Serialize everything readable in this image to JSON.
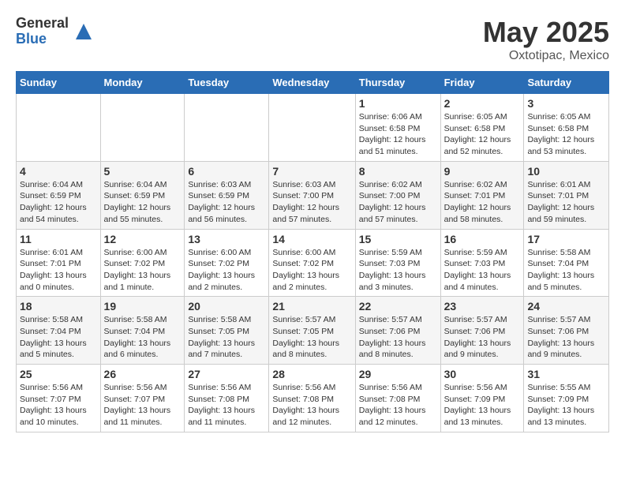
{
  "logo": {
    "general": "General",
    "blue": "Blue"
  },
  "title": "May 2025",
  "location": "Oxtotipac, Mexico",
  "days_of_week": [
    "Sunday",
    "Monday",
    "Tuesday",
    "Wednesday",
    "Thursday",
    "Friday",
    "Saturday"
  ],
  "weeks": [
    [
      {
        "day": "",
        "info": ""
      },
      {
        "day": "",
        "info": ""
      },
      {
        "day": "",
        "info": ""
      },
      {
        "day": "",
        "info": ""
      },
      {
        "day": "1",
        "info": "Sunrise: 6:06 AM\nSunset: 6:58 PM\nDaylight: 12 hours\nand 51 minutes."
      },
      {
        "day": "2",
        "info": "Sunrise: 6:05 AM\nSunset: 6:58 PM\nDaylight: 12 hours\nand 52 minutes."
      },
      {
        "day": "3",
        "info": "Sunrise: 6:05 AM\nSunset: 6:58 PM\nDaylight: 12 hours\nand 53 minutes."
      }
    ],
    [
      {
        "day": "4",
        "info": "Sunrise: 6:04 AM\nSunset: 6:59 PM\nDaylight: 12 hours\nand 54 minutes."
      },
      {
        "day": "5",
        "info": "Sunrise: 6:04 AM\nSunset: 6:59 PM\nDaylight: 12 hours\nand 55 minutes."
      },
      {
        "day": "6",
        "info": "Sunrise: 6:03 AM\nSunset: 6:59 PM\nDaylight: 12 hours\nand 56 minutes."
      },
      {
        "day": "7",
        "info": "Sunrise: 6:03 AM\nSunset: 7:00 PM\nDaylight: 12 hours\nand 57 minutes."
      },
      {
        "day": "8",
        "info": "Sunrise: 6:02 AM\nSunset: 7:00 PM\nDaylight: 12 hours\nand 57 minutes."
      },
      {
        "day": "9",
        "info": "Sunrise: 6:02 AM\nSunset: 7:01 PM\nDaylight: 12 hours\nand 58 minutes."
      },
      {
        "day": "10",
        "info": "Sunrise: 6:01 AM\nSunset: 7:01 PM\nDaylight: 12 hours\nand 59 minutes."
      }
    ],
    [
      {
        "day": "11",
        "info": "Sunrise: 6:01 AM\nSunset: 7:01 PM\nDaylight: 13 hours\nand 0 minutes."
      },
      {
        "day": "12",
        "info": "Sunrise: 6:00 AM\nSunset: 7:02 PM\nDaylight: 13 hours\nand 1 minute."
      },
      {
        "day": "13",
        "info": "Sunrise: 6:00 AM\nSunset: 7:02 PM\nDaylight: 13 hours\nand 2 minutes."
      },
      {
        "day": "14",
        "info": "Sunrise: 6:00 AM\nSunset: 7:02 PM\nDaylight: 13 hours\nand 2 minutes."
      },
      {
        "day": "15",
        "info": "Sunrise: 5:59 AM\nSunset: 7:03 PM\nDaylight: 13 hours\nand 3 minutes."
      },
      {
        "day": "16",
        "info": "Sunrise: 5:59 AM\nSunset: 7:03 PM\nDaylight: 13 hours\nand 4 minutes."
      },
      {
        "day": "17",
        "info": "Sunrise: 5:58 AM\nSunset: 7:04 PM\nDaylight: 13 hours\nand 5 minutes."
      }
    ],
    [
      {
        "day": "18",
        "info": "Sunrise: 5:58 AM\nSunset: 7:04 PM\nDaylight: 13 hours\nand 5 minutes."
      },
      {
        "day": "19",
        "info": "Sunrise: 5:58 AM\nSunset: 7:04 PM\nDaylight: 13 hours\nand 6 minutes."
      },
      {
        "day": "20",
        "info": "Sunrise: 5:58 AM\nSunset: 7:05 PM\nDaylight: 13 hours\nand 7 minutes."
      },
      {
        "day": "21",
        "info": "Sunrise: 5:57 AM\nSunset: 7:05 PM\nDaylight: 13 hours\nand 8 minutes."
      },
      {
        "day": "22",
        "info": "Sunrise: 5:57 AM\nSunset: 7:06 PM\nDaylight: 13 hours\nand 8 minutes."
      },
      {
        "day": "23",
        "info": "Sunrise: 5:57 AM\nSunset: 7:06 PM\nDaylight: 13 hours\nand 9 minutes."
      },
      {
        "day": "24",
        "info": "Sunrise: 5:57 AM\nSunset: 7:06 PM\nDaylight: 13 hours\nand 9 minutes."
      }
    ],
    [
      {
        "day": "25",
        "info": "Sunrise: 5:56 AM\nSunset: 7:07 PM\nDaylight: 13 hours\nand 10 minutes."
      },
      {
        "day": "26",
        "info": "Sunrise: 5:56 AM\nSunset: 7:07 PM\nDaylight: 13 hours\nand 11 minutes."
      },
      {
        "day": "27",
        "info": "Sunrise: 5:56 AM\nSunset: 7:08 PM\nDaylight: 13 hours\nand 11 minutes."
      },
      {
        "day": "28",
        "info": "Sunrise: 5:56 AM\nSunset: 7:08 PM\nDaylight: 13 hours\nand 12 minutes."
      },
      {
        "day": "29",
        "info": "Sunrise: 5:56 AM\nSunset: 7:08 PM\nDaylight: 13 hours\nand 12 minutes."
      },
      {
        "day": "30",
        "info": "Sunrise: 5:56 AM\nSunset: 7:09 PM\nDaylight: 13 hours\nand 13 minutes."
      },
      {
        "day": "31",
        "info": "Sunrise: 5:55 AM\nSunset: 7:09 PM\nDaylight: 13 hours\nand 13 minutes."
      }
    ]
  ]
}
